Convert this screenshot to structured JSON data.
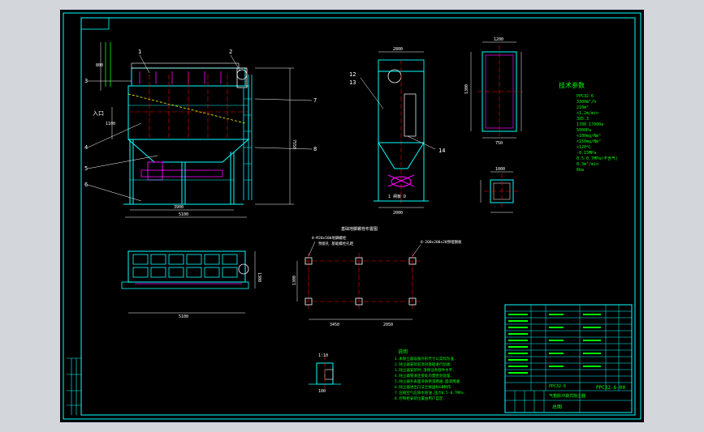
{
  "colors": {
    "background": "#000000",
    "frame": "#ffffff",
    "border": "#00ffff",
    "structure": "#00ffff",
    "dimension": "#ffffff",
    "centerline": "#ff0000",
    "text": "#00ff00",
    "hatch": "#ffff00",
    "highlight": "#ff00ff"
  },
  "front_view": {
    "leaders": [
      "1",
      "2",
      "3",
      "4",
      "5",
      "6",
      "7",
      "8",
      "9",
      "10"
    ],
    "label_inlet": "入口",
    "dims": [
      "3900",
      "5100",
      "7550",
      "1100",
      "800"
    ]
  },
  "side_view": {
    "leaders": [
      "12",
      "13",
      "14"
    ],
    "dims": [
      "2800",
      "2000"
    ],
    "label_gate": "1 闸板 D"
  },
  "top_detail": {
    "dims": [
      "1200",
      "750",
      "1300",
      "1000"
    ]
  },
  "tech_params": {
    "title": "技术参数",
    "lines": [
      "PPC32-6",
      "3300m³/h",
      "210m²",
      "<1.2m/min",
      "3X5.3",
      "1700 17000a",
      "5000Pa",
      "<100mg/Nm³",
      "<150mg/Nm³",
      "<120℃",
      "-0.15MPa",
      "0.5-0.7MPa(不含气)",
      "0.3m³/min",
      "6kw"
    ]
  },
  "plan_view": {
    "dims": [
      "5100",
      "5050",
      "2450",
      "1300"
    ]
  },
  "foundation_plan": {
    "title": "基础地脚螺栓布置图",
    "note_a": "8-M20x500地脚螺栓",
    "note_b": "预留孔 基础螺栓孔距",
    "note_c": "8-200x200x20预埋钢板",
    "dims": [
      "3450",
      "2050",
      "1300"
    ]
  },
  "small_detail": {
    "dims": [
      "1:10",
      "100"
    ]
  },
  "notes": {
    "title": "说明",
    "lines": [
      "1.本除尘器设备外形尺寸以实际为准.",
      "2.除尘器安装前须对基础进行验收.",
      "3.除尘器安装时,须保证各部件水平.",
      "4.除尘器管道连接处均需密封处理.",
      "5.除尘器外表面涂防锈漆两遍,面漆两遍.",
      "6.除尘器进出口法兰按国标GB制作.",
      "7.压缩空气应除水除油,压力0.5-0.7MPa.",
      "8.控制柜安装位置由用户自定."
    ]
  },
  "title_block": {
    "drawing_no": "PPC32-6-00",
    "model": "PPC32-6",
    "name": "气箱脉冲袋式除尘器",
    "sheet_type": "总图"
  }
}
